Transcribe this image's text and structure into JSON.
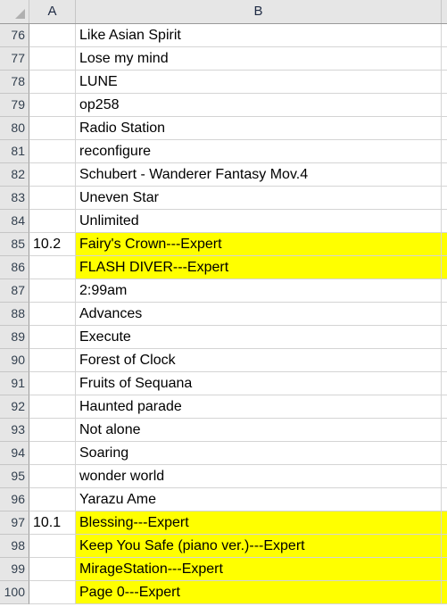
{
  "app": {
    "type": "spreadsheet",
    "select_all_icon": "select-all-corner-triangle"
  },
  "colors": {
    "highlight": "#FFFF00",
    "header_background": "#E6E6E6",
    "gridline": "#D4D4D4",
    "header_text": "#1F2B44",
    "row_header_text": "#33404F"
  },
  "columns": [
    {
      "id": "A",
      "label": "A"
    },
    {
      "id": "B",
      "label": "B"
    },
    {
      "id": "C",
      "label": ""
    }
  ],
  "rows": [
    {
      "num": "76",
      "a": "",
      "b": "Like Asian Spirit",
      "highlight": false
    },
    {
      "num": "77",
      "a": "",
      "b": "Lose my mind",
      "highlight": false
    },
    {
      "num": "78",
      "a": "",
      "b": "LUNE",
      "highlight": false
    },
    {
      "num": "79",
      "a": "",
      "b": "op258",
      "highlight": false
    },
    {
      "num": "80",
      "a": "",
      "b": "Radio Station",
      "highlight": false
    },
    {
      "num": "81",
      "a": "",
      "b": "reconfigure",
      "highlight": false
    },
    {
      "num": "82",
      "a": "",
      "b": "Schubert - Wanderer Fantasy Mov.4",
      "highlight": false
    },
    {
      "num": "83",
      "a": "",
      "b": "Uneven Star",
      "highlight": false
    },
    {
      "num": "84",
      "a": "",
      "b": "Unlimited",
      "highlight": false
    },
    {
      "num": "85",
      "a": "10.2",
      "b": "Fairy's Crown---Expert",
      "highlight": true
    },
    {
      "num": "86",
      "a": "",
      "b": "FLASH DIVER---Expert",
      "highlight": true
    },
    {
      "num": "87",
      "a": "",
      "b": "2:99am",
      "highlight": false
    },
    {
      "num": "88",
      "a": "",
      "b": "Advances",
      "highlight": false
    },
    {
      "num": "89",
      "a": "",
      "b": "Execute",
      "highlight": false
    },
    {
      "num": "90",
      "a": "",
      "b": "Forest of Clock",
      "highlight": false
    },
    {
      "num": "91",
      "a": "",
      "b": "Fruits of Sequana",
      "highlight": false
    },
    {
      "num": "92",
      "a": "",
      "b": "Haunted parade",
      "highlight": false
    },
    {
      "num": "93",
      "a": "",
      "b": "Not alone",
      "highlight": false
    },
    {
      "num": "94",
      "a": "",
      "b": "Soaring",
      "highlight": false
    },
    {
      "num": "95",
      "a": "",
      "b": "wonder world",
      "highlight": false
    },
    {
      "num": "96",
      "a": "",
      "b": "Yarazu Ame",
      "highlight": false
    },
    {
      "num": "97",
      "a": "10.1",
      "b": "Blessing---Expert",
      "highlight": true
    },
    {
      "num": "98",
      "a": "",
      "b": "Keep You Safe (piano ver.)---Expert",
      "highlight": true
    },
    {
      "num": "99",
      "a": "",
      "b": "MirageStation---Expert",
      "highlight": true
    },
    {
      "num": "100",
      "a": "",
      "b": "Page 0---Expert",
      "highlight": true
    }
  ]
}
